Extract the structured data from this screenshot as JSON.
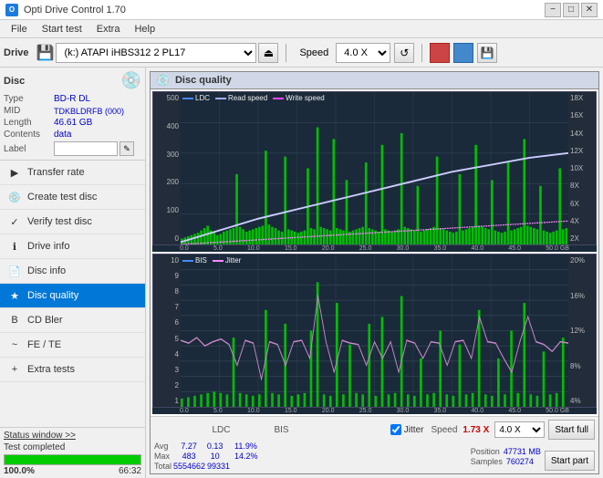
{
  "titlebar": {
    "icon": "O",
    "title": "Opti Drive Control 1.70",
    "minimize": "−",
    "maximize": "□",
    "close": "✕"
  },
  "menubar": {
    "items": [
      "File",
      "Start test",
      "Extra",
      "Help"
    ]
  },
  "toolbar": {
    "drive_label": "Drive",
    "drive_value": "(k:) ATAPI iHBS312  2 PL17",
    "speed_label": "Speed",
    "speed_value": "4.0 X"
  },
  "disc": {
    "title": "Disc",
    "type_label": "Type",
    "type_value": "BD-R DL",
    "mid_label": "MID",
    "mid_value": "TDKBLDRFB (000)",
    "length_label": "Length",
    "length_value": "46.61 GB",
    "contents_label": "Contents",
    "contents_value": "data",
    "label_label": "Label"
  },
  "nav": {
    "items": [
      {
        "id": "transfer-rate",
        "label": "Transfer rate",
        "icon": "▶"
      },
      {
        "id": "create-test-disc",
        "label": "Create test disc",
        "icon": "💿"
      },
      {
        "id": "verify-test-disc",
        "label": "Verify test disc",
        "icon": "✓"
      },
      {
        "id": "drive-info",
        "label": "Drive info",
        "icon": "ℹ"
      },
      {
        "id": "disc-info",
        "label": "Disc info",
        "icon": "📄"
      },
      {
        "id": "disc-quality",
        "label": "Disc quality",
        "icon": "★",
        "active": true
      },
      {
        "id": "cd-bler",
        "label": "CD Bler",
        "icon": "B"
      },
      {
        "id": "fe-te",
        "label": "FE / TE",
        "icon": "~"
      },
      {
        "id": "extra-tests",
        "label": "Extra tests",
        "icon": "+"
      }
    ]
  },
  "dq_panel": {
    "title": "Disc quality",
    "legend1_label": "LDC",
    "legend2_label": "Read speed",
    "legend3_label": "Write speed",
    "legend_bis_label": "BIS",
    "legend_jitter_label": "Jitter"
  },
  "chart1": {
    "y_labels_left": [
      "500",
      "400",
      "300",
      "200",
      "100",
      "0"
    ],
    "y_labels_right": [
      "18X",
      "16X",
      "14X",
      "12X",
      "10X",
      "8X",
      "6X",
      "4X",
      "2X"
    ],
    "x_labels": [
      "0.0",
      "5.0",
      "10.0",
      "15.0",
      "20.0",
      "25.0",
      "30.0",
      "35.0",
      "40.0",
      "45.0",
      "50.0 GB"
    ]
  },
  "chart2": {
    "y_labels_left": [
      "10",
      "9",
      "8",
      "7",
      "6",
      "5",
      "4",
      "3",
      "2",
      "1"
    ],
    "y_labels_right": [
      "20%",
      "16%",
      "12%",
      "8%",
      "4%"
    ],
    "x_labels": [
      "0.0",
      "5.0",
      "10.0",
      "15.0",
      "20.0",
      "25.0",
      "30.0",
      "35.0",
      "40.0",
      "45.0",
      "50.0 GB"
    ]
  },
  "stats": {
    "ldc_label": "LDC",
    "bis_label": "BIS",
    "jitter_label": "Jitter",
    "speed_label": "Speed",
    "avg_label": "Avg",
    "max_label": "Max",
    "total_label": "Total",
    "ldc_avg": "7.27",
    "ldc_max": "483",
    "ldc_total": "5554662",
    "bis_avg": "0.13",
    "bis_max": "10",
    "bis_total": "99331",
    "jitter_avg": "11.9%",
    "jitter_max": "14.2%",
    "jitter_total": "",
    "speed_val": "1.73 X",
    "speed_select": "4.0 X",
    "position_label": "Position",
    "position_val": "47731 MB",
    "samples_label": "Samples",
    "samples_val": "760274",
    "start_full": "Start full",
    "start_part": "Start part"
  },
  "statusbar": {
    "status_window": "Status window >>",
    "status_text": "Test completed",
    "progress": 100,
    "progress_pct": "100.0%",
    "time": "66:32"
  }
}
